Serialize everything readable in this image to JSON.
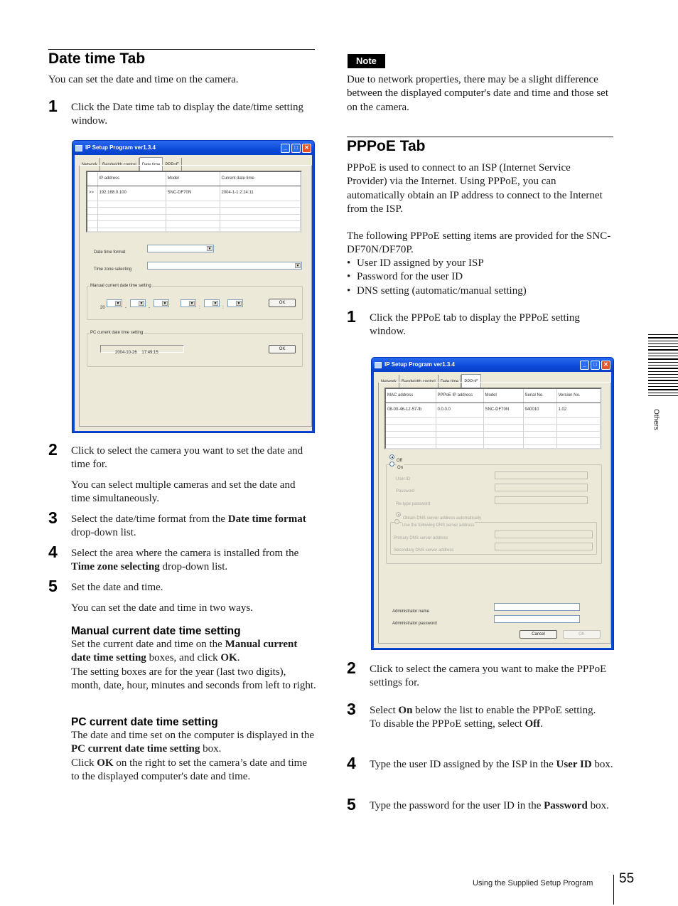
{
  "left": {
    "date_time_tab": {
      "title": "Date time Tab",
      "intro": "You can set the date and time on the camera.",
      "step1": {
        "num": "1",
        "text": "Click the Date time tab to display the date/time setting window."
      },
      "step2": {
        "num": "2",
        "text": "Click to select the camera you want to set the date and time for.",
        "sub": "You can select multiple cameras and set the date and time simultaneously."
      },
      "step3": {
        "num": "3",
        "pre": "Select the date/time format from the ",
        "bold": "Date time format",
        "post": " drop-down list."
      },
      "step4": {
        "num": "4",
        "pre": "Select the area where the camera is installed from the ",
        "bold": "Time zone selecting",
        "post": " drop-down list."
      },
      "step5": {
        "num": "5",
        "text": "Set the date and time.",
        "sub": "You can set the date and time in two ways."
      },
      "manual": {
        "heading": "Manual current date time setting",
        "p1": "Set the current date and time on the ",
        "b1": "Manual current date time setting",
        "p2": " boxes, and click ",
        "b2": "OK",
        "p3": ".",
        "p4": "The setting boxes are for the year (last two digits), month, date, hour, minutes and seconds from left to right."
      },
      "pc": {
        "heading": "PC current date time setting",
        "p1": "The date and time set on the computer is displayed in the ",
        "b1": "PC current date time setting",
        "p2": " box.",
        "p3": "Click ",
        "b2": "OK",
        "p4": " on the right to set the camera’s date and time to the displayed computer's date and time."
      }
    },
    "window": {
      "title": "IP Setup Program ver1.3.4",
      "tabs": [
        "Network",
        "Bandwidth control",
        "Date time",
        "PPPoE"
      ],
      "active_tab": "Date time",
      "columns": [
        "",
        "IP address",
        "Model",
        "Current date time"
      ],
      "rows": [
        [
          ">>",
          "192.168.0.100",
          "SNC-DF70N",
          "2004-1-1  2:24:11"
        ]
      ],
      "date_time_format_label": "Date time format",
      "time_zone_label": "Time zone selecting",
      "manual_group": "Manual current date time setting",
      "year_prefix": "20",
      "date_sep": "-",
      "time_sep": ":",
      "ok": "OK",
      "pc_group": "PC current date time setting",
      "pc_value": "2004-10-26    17:49:15"
    }
  },
  "right": {
    "note": {
      "badge": "Note",
      "text": "Due to network properties, there may be a slight difference between the displayed computer's date and time and those set on the camera."
    },
    "pppoe_tab": {
      "title": "PPPoE Tab",
      "intro": "PPPoE is used to connect to an ISP (Internet Service Provider) via the Internet. Using PPPoE, you can automatically obtain an IP address to connect to the Internet from the ISP.",
      "items_intro": "The following PPPoE setting items are provided for the SNC-DF70N/DF70P.",
      "items": [
        "User ID assigned by your ISP",
        "Password for the user ID",
        "DNS setting (automatic/manual setting)"
      ],
      "step1": {
        "num": "1",
        "text": "Click the PPPoE tab to display the PPPoE setting window."
      },
      "step2": {
        "num": "2",
        "text": "Click to select the camera you want to make the PPPoE settings for."
      },
      "step3": {
        "num": "3",
        "pre": "Select ",
        "bold": "On",
        "post": " below the list to enable the PPPoE setting.",
        "line2_pre": "To disable the PPPoE setting, select ",
        "line2_bold": "Off",
        "line2_post": "."
      },
      "step4": {
        "num": "4",
        "pre": "Type the user ID assigned by the ISP in the ",
        "bold": "User ID",
        "post": " box."
      },
      "step5": {
        "num": "5",
        "pre": "Type the password for the user ID in the ",
        "bold": "Password",
        "post": " box."
      }
    },
    "window": {
      "title": "IP Setup Program ver1.3.4",
      "tabs": [
        "Network",
        "Bandwidth control",
        "Date time",
        "PPPoE"
      ],
      "active_tab": "PPPoE",
      "columns": [
        "MAC address",
        "PPPoE IP address",
        "Model",
        "Serial No.",
        "Version No."
      ],
      "rows": [
        [
          "08-00-46-12-57-fb",
          "0.0.0.0",
          "SNC-DF70N",
          "940010",
          "1.02"
        ]
      ],
      "off_label": "Off",
      "on_label": "On",
      "pppoe_state": "Off",
      "user_id_label": "User ID",
      "password_label": "Password",
      "retype_label": "Re-type password",
      "dns_auto_label": "Obtain DNS server address automatically",
      "dns_manual_label": "Use the following DNS server address",
      "primary_dns_label": "Primary DNS server address",
      "secondary_dns_label": "Secondary DNS server address",
      "admin_name_label": "Administrator name",
      "admin_password_label": "Administrator password",
      "cancel": "Cancel",
      "ok": "OK"
    }
  },
  "side": {
    "label": "Others"
  },
  "footer": {
    "section": "Using the Supplied Setup Program",
    "page": "55"
  }
}
